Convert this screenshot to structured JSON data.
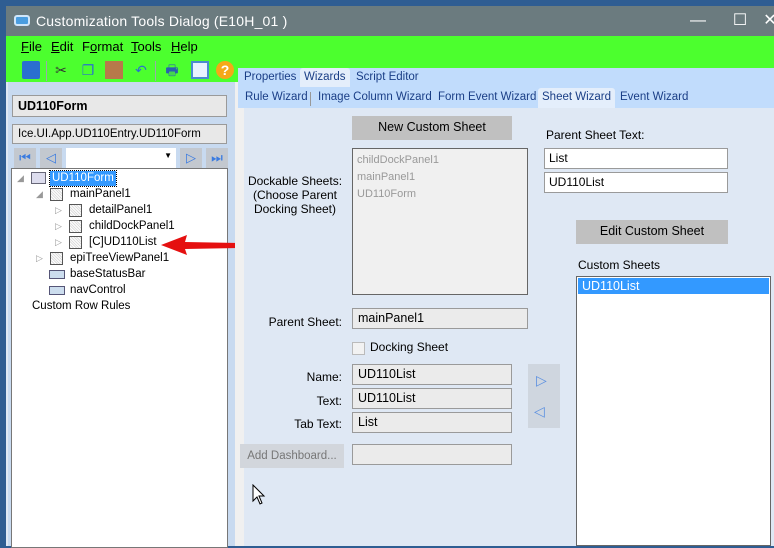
{
  "window": {
    "title": "Customization Tools Dialog  (E10H_01 )",
    "minimize": "—",
    "maximize": "☐",
    "close": "✕"
  },
  "menu": [
    {
      "key": "F",
      "rest": "ile"
    },
    {
      "key": "E",
      "rest": "dit"
    },
    {
      "pre": "F",
      "key": "o",
      "rest": "rmat"
    },
    {
      "key": "T",
      "rest": "ools"
    },
    {
      "key": "H",
      "rest": "elp"
    }
  ],
  "toolbar": [
    "save-icon",
    "cut-icon",
    "copy-icon",
    "paste-icon",
    "undo-icon",
    "print-icon",
    "preview-icon",
    "help-icon"
  ],
  "left": {
    "form_name": "UD110Form",
    "form_class": "Ice.UI.App.UD110Entry.UD110Form",
    "nav_value": ""
  },
  "tree": [
    {
      "label": "UD110Form",
      "selected": true
    },
    {
      "label": "mainPanel1"
    },
    {
      "label": "detailPanel1"
    },
    {
      "label": "childDockPanel1"
    },
    {
      "label": "[C]UD110List"
    },
    {
      "label": "epiTreeViewPanel1"
    },
    {
      "label": "baseStatusBar"
    },
    {
      "label": "navControl"
    },
    {
      "label": "Custom Row Rules"
    }
  ],
  "tabs": [
    "Properties",
    "Wizards",
    "Script Editor"
  ],
  "active_tab": "Wizards",
  "subtabs": [
    "Rule Wizard",
    "Image Column Wizard",
    "Form Event Wizard",
    "Sheet Wizard",
    "Event Wizard"
  ],
  "active_subtab": "Sheet Wizard",
  "sheet": {
    "new_button": "New Custom Sheet",
    "dockable_label": "Dockable Sheets:\n(Choose Parent\nDocking Sheet)",
    "dockable_items": [
      "childDockPanel1",
      "mainPanel1",
      "UD110Form"
    ],
    "parent_sheet_label": "Parent Sheet:",
    "parent_sheet_value": "mainPanel1",
    "docking_label": "Docking Sheet",
    "name_label": "Name:",
    "name_value": "UD110List",
    "text_label": "Text:",
    "text_value": "UD110List",
    "tabtext_label": "Tab Text:",
    "tabtext_value": "List",
    "add_dashboard": "Add Dashboard...",
    "dashboard_value": "",
    "parent_text_label": "Parent Sheet Text:",
    "parent_text_1": "List",
    "parent_text_2": "UD110List",
    "edit_button": "Edit Custom Sheet",
    "custom_label": "Custom Sheets",
    "custom_items": [
      "UD110List"
    ]
  },
  "colors": {
    "accent": "#3399ff",
    "menu_bg": "#4cff2e",
    "title_bg": "#6b7b7f",
    "arrow": "#e51010"
  }
}
